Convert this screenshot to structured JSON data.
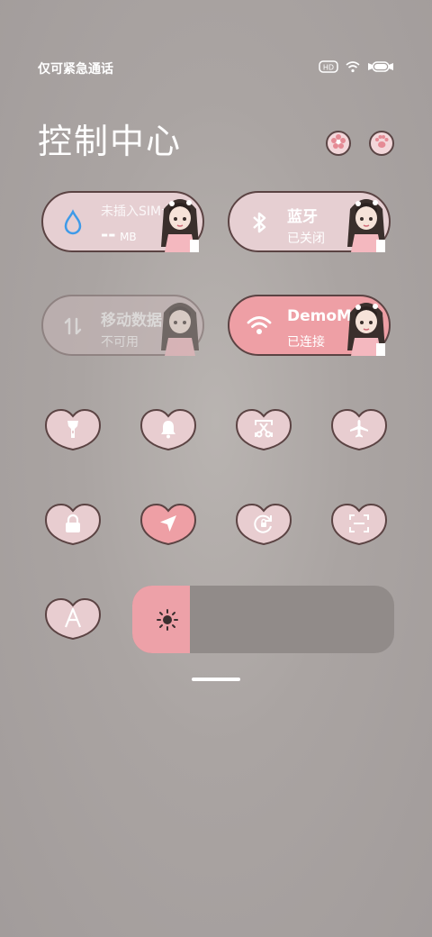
{
  "status_bar": {
    "carrier_text": "仅可紧急通话",
    "icons": [
      "hd-icon",
      "wifi-icon",
      "battery-icon"
    ]
  },
  "header": {
    "title": "控制中心",
    "buttons": [
      "flower-edit-icon",
      "paw-settings-icon"
    ]
  },
  "tiles": [
    {
      "title": "未插入SIM卡",
      "subtitle_value": "--",
      "subtitle_unit": "MB",
      "icon": "water-drop-icon",
      "state": "off"
    },
    {
      "title": "蓝牙",
      "subtitle": "已关闭",
      "icon": "bluetooth-icon",
      "state": "off"
    },
    {
      "title": "移动数据",
      "subtitle": "不可用",
      "icon": "mobile-data-icon",
      "state": "disabled"
    },
    {
      "title": "DemoMode",
      "subtitle": "已连接",
      "icon": "wifi-icon",
      "state": "on"
    }
  ],
  "toggles": [
    {
      "icon": "flashlight-icon",
      "active": false
    },
    {
      "icon": "bell-icon",
      "active": false
    },
    {
      "icon": "screenshot-icon",
      "active": false
    },
    {
      "icon": "airplane-icon",
      "active": false
    },
    {
      "icon": "lock-icon",
      "active": false
    },
    {
      "icon": "location-icon",
      "active": true
    },
    {
      "icon": "auto-rotate-icon",
      "active": false
    },
    {
      "icon": "scan-icon",
      "active": false
    },
    {
      "icon": "auto-brightness-icon",
      "active": false
    }
  ],
  "brightness": {
    "level": 0.22,
    "icon": "sun-icon"
  },
  "colors": {
    "pill_light": "#e6cfd2",
    "pill_pink": "#ee9fa5",
    "heart_fill": "#e8cdd0",
    "heart_active": "#ee9fa5",
    "outline": "#5b4343"
  }
}
